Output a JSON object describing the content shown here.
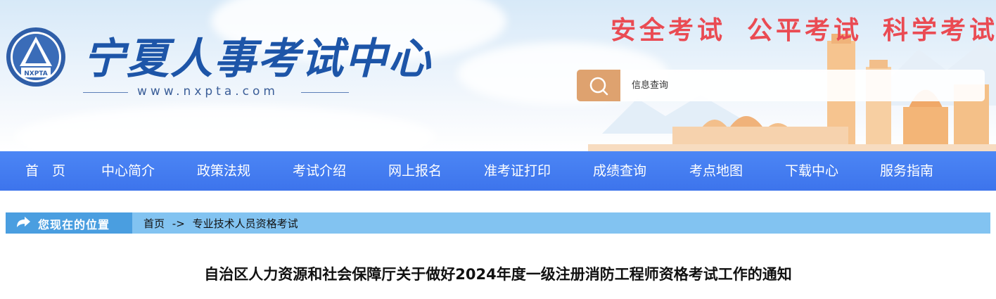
{
  "header": {
    "site_name": "宁夏人事考试中心",
    "site_url": "www.nxpta.com",
    "logo_text": "NXPTA",
    "slogans": [
      "安全考试",
      "公平考试",
      "科学考试"
    ]
  },
  "search": {
    "placeholder": "信息查询"
  },
  "nav": {
    "items": [
      "首　页",
      "中心简介",
      "政策法规",
      "考试介绍",
      "网上报名",
      "准考证打印",
      "成绩查询",
      "考点地图",
      "下载中心",
      "服务指南"
    ]
  },
  "location": {
    "label": "您现在的位置",
    "home": "首页",
    "separator": "->",
    "current": "专业技术人员资格考试"
  },
  "article": {
    "title": "自治区人力资源和社会保障厅关于做好2024年度一级注册消防工程师资格考试工作的通知"
  },
  "colors": {
    "nav_bg": "#3d74ec",
    "slogan": "#ea4b53",
    "search_button": "#dea26f",
    "location_bar": "#82c3f1"
  }
}
